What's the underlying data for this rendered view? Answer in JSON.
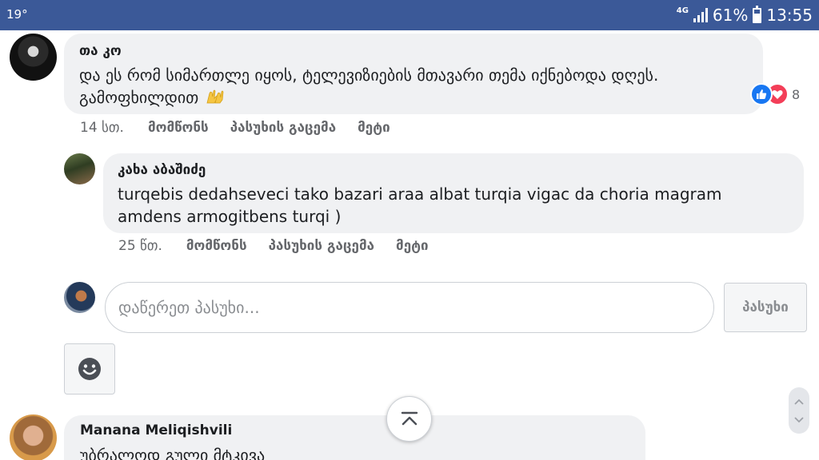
{
  "status_bar": {
    "temperature": "19°",
    "network": "4G",
    "battery": "61%",
    "battery_level": 0.61,
    "time": "13:55"
  },
  "comments": [
    {
      "author": "თა კო",
      "text": "და ეს რომ სიმართლე იყოს, ტელევიზიების მთავარი თემა იქნებოდა დღეს. გამოფხილდით",
      "time": "14 სთ.",
      "like_label": "მომწონს",
      "reply_label": "პასუხის გაცემა",
      "more_label": "მეტი",
      "reactions_count": "8"
    },
    {
      "author": "კახა აბაშიძე",
      "text": "turqebis dedahseveci tako bazari araa albat turqia vigac da choria magram amdens armogitbens turqi )",
      "time": "25 წთ.",
      "like_label": "მომწონს",
      "reply_label": "პასუხის გაცემა",
      "more_label": "მეტი"
    },
    {
      "author": "Manana Meliqishvili",
      "text": "უბრალოდ გული მტკივა"
    }
  ],
  "reply_box": {
    "placeholder": "დაწერეთ პასუხი...",
    "submit_label": "პასუხი"
  },
  "icons": {
    "emoji_button": "smiley-icon",
    "scroll_top": "chevron-up-double-icon",
    "like_reaction": "thumbs-up-icon",
    "love_reaction": "heart-icon"
  },
  "colors": {
    "status_bar": "#3b5998",
    "bubble": "#f0f1f3",
    "like": "#1877f2",
    "love": "#f33e58"
  }
}
